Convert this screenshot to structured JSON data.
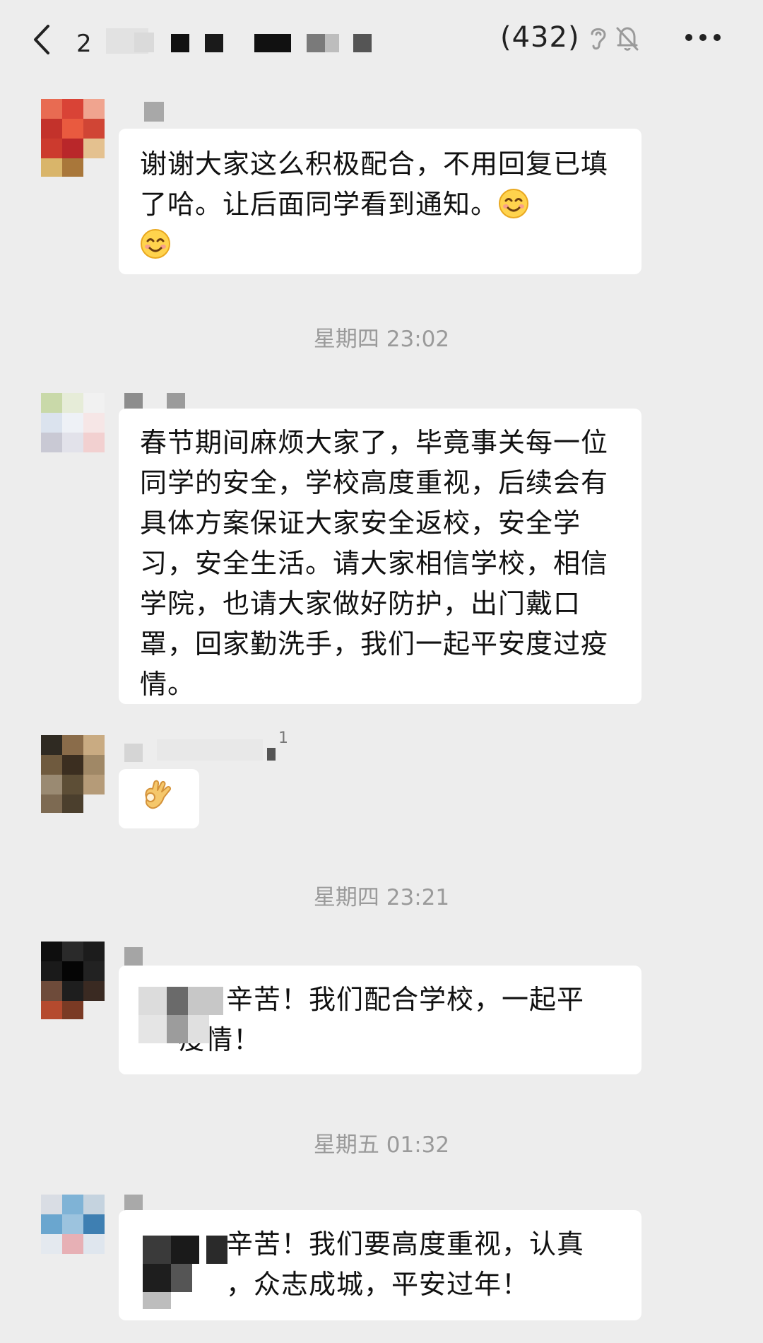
{
  "header": {
    "back_badge": "2",
    "member_count": "(432)",
    "icons": [
      "back-chevron-icon",
      "ear-icon",
      "mute-bell-icon",
      "more-dots-icon"
    ]
  },
  "messages": [
    {
      "id": "m1",
      "text": "谢谢大家这么积极配合，不用回复已填了哈。让后面同学看到通知。",
      "emojis": [
        "smiling-face-emoji",
        "smiling-face-emoji"
      ]
    },
    {
      "id": "ts1",
      "timestamp": "星期四 23:02"
    },
    {
      "id": "m2",
      "text": "春节期间麻烦大家了，毕竟事关每一位同学的安全，学校高度重视，后续会有具体方案保证大家安全返校，安全学习，安全生活。请大家相信学校，相信学院，也请大家做好防护，出门戴口罩，回家勤洗手，我们一起平安度过疫情。"
    },
    {
      "id": "m3",
      "emojis": [
        "ok-hand-emoji"
      ],
      "nick_suffix": "1"
    },
    {
      "id": "ts2",
      "timestamp": "星期四 23:21"
    },
    {
      "id": "m4",
      "text_line1": "辛苦！我们配合学校，一起平",
      "text_line2": "疫情！"
    },
    {
      "id": "ts3",
      "timestamp": "星期五 01:32"
    },
    {
      "id": "m5",
      "text_line1": "辛苦！我们要高度重视，认真",
      "text_line2": "，众志成城，平安过年！"
    }
  ],
  "colors": {
    "background": "#ededed",
    "bubble": "#ffffff",
    "timestamp": "#9a9a9a",
    "text": "#111111"
  }
}
